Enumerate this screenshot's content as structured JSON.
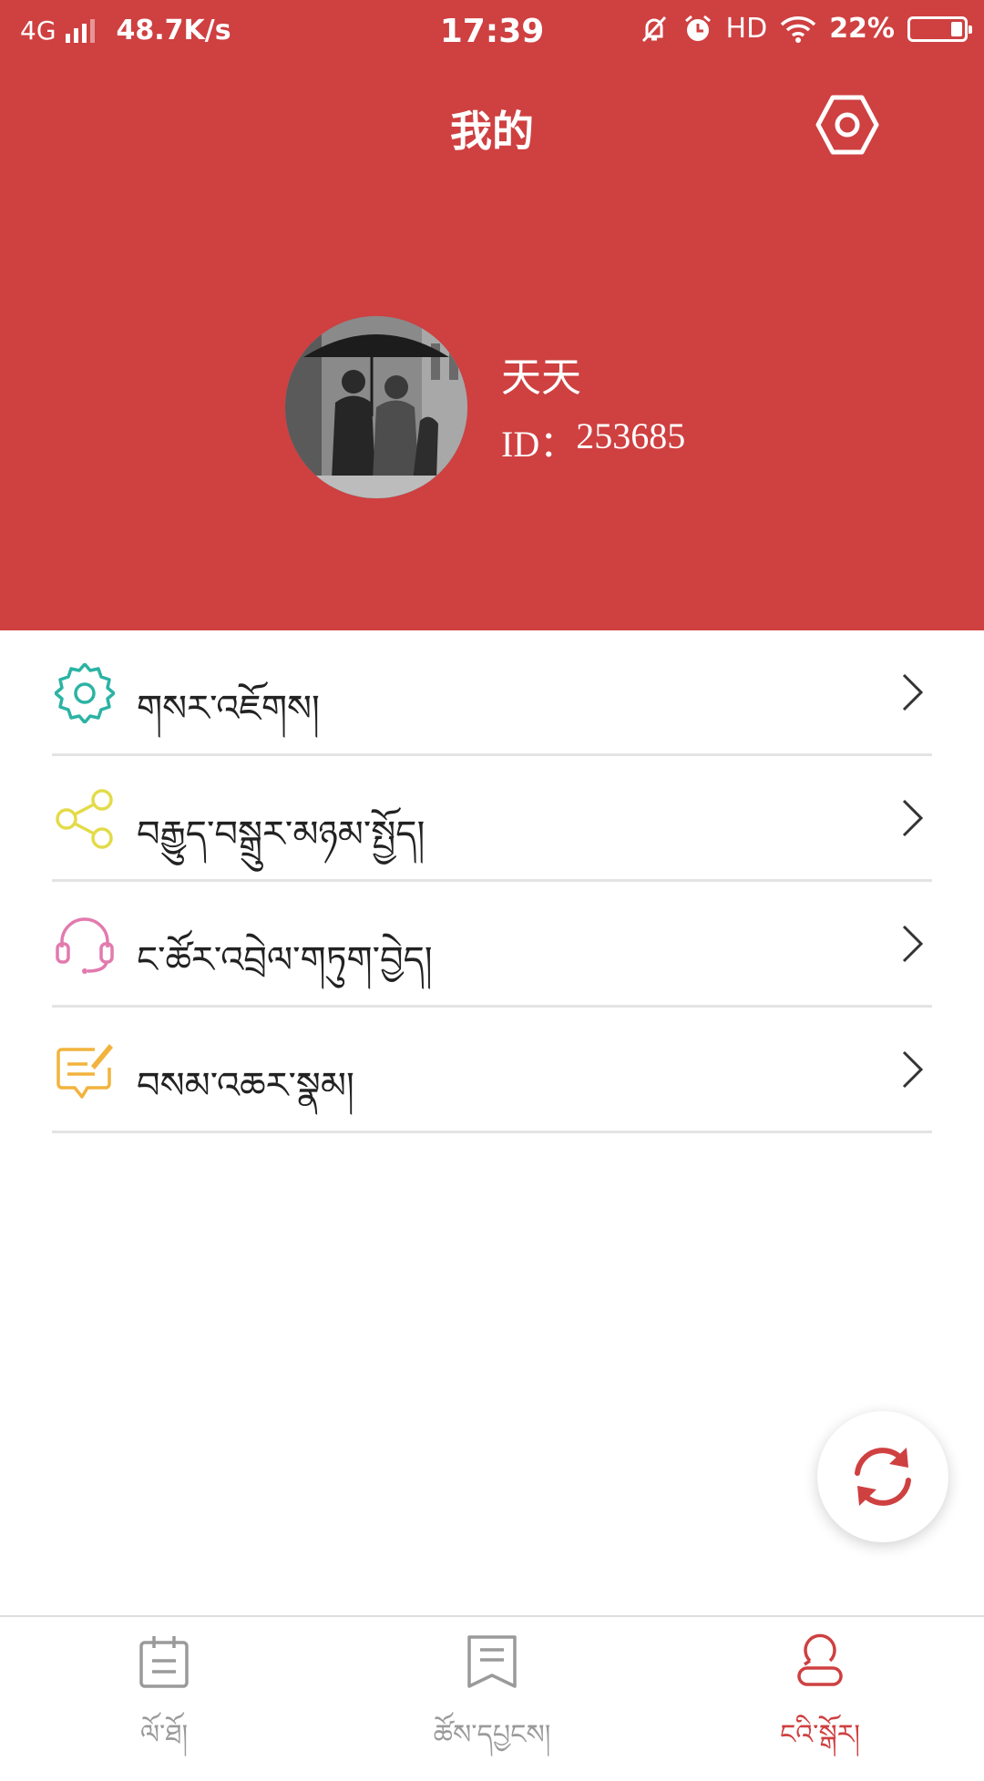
{
  "status_bar": {
    "network": "4G",
    "speed": "48.7K/s",
    "time": "17:39",
    "hd": "HD",
    "battery": "22%",
    "battery_level": 0.22
  },
  "header": {
    "title": "我的"
  },
  "profile": {
    "name": "天天",
    "id_label": "ID：",
    "id_value": "253685"
  },
  "menu": {
    "items": [
      {
        "label": "གསར་འཇོགས།",
        "icon": "gear-icon",
        "color": "#2bb3a4"
      },
      {
        "label": "བརྒྱུད་བསྒྲུར་མཉམ་སྤྱོད།",
        "icon": "share-icon",
        "color": "#e3db48"
      },
      {
        "label": "ང་ཚོར་འབྲེལ་གཏུག་བྱེད།",
        "icon": "headset-icon",
        "color": "#e27aae"
      },
      {
        "label": "བསམ་འཆར་སྣམ།",
        "icon": "feedback-icon",
        "color": "#f2b33d"
      }
    ]
  },
  "bottom_nav": {
    "items": [
      {
        "label": "ལོ་ཐོ།",
        "icon": "calendar-icon",
        "active": false
      },
      {
        "label": "ཚོས་དཔྱངས།",
        "icon": "book-icon",
        "active": false
      },
      {
        "label": "ངའི་སྒོར།",
        "icon": "person-icon",
        "active": true
      }
    ]
  },
  "colors": {
    "brand_red": "#cf4041",
    "divider": "#e4e4e4",
    "inactive": "#9a9a9a"
  }
}
